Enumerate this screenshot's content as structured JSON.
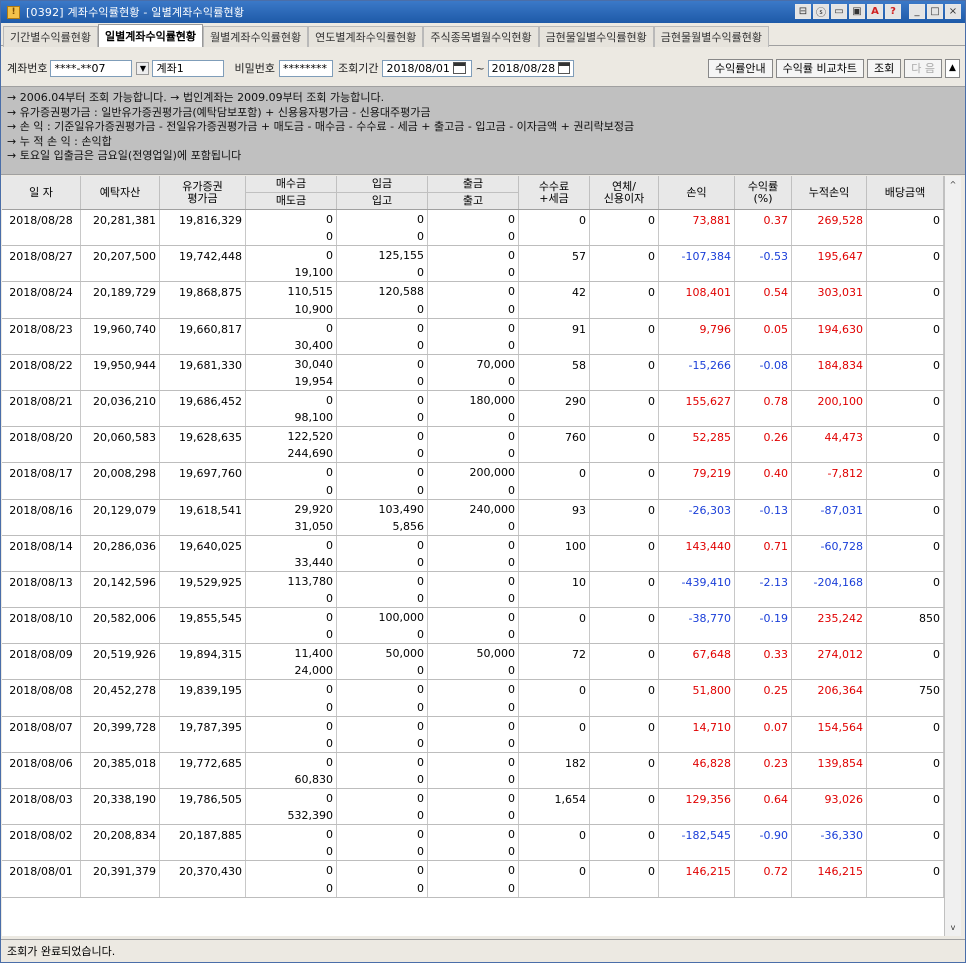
{
  "window": {
    "title": "[0392] 계좌수익률현황 - 일별계좌수익률현황",
    "buttons": [
      "⊟",
      "ⓢ",
      "▭",
      "▣",
      "A",
      "?",
      "_",
      "□",
      "×"
    ]
  },
  "tabs": [
    {
      "label": "기간별수익률현황",
      "active": false
    },
    {
      "label": "일별계좌수익률현황",
      "active": true
    },
    {
      "label": "월별계좌수익률현황",
      "active": false
    },
    {
      "label": "연도별계좌수익률현황",
      "active": false
    },
    {
      "label": "주식종목별월수익현황",
      "active": false
    },
    {
      "label": "금현물일별수익률현황",
      "active": false
    },
    {
      "label": "금현물월별수익률현황",
      "active": false
    }
  ],
  "query": {
    "account_label": "계좌번호",
    "account_value": "****-**07",
    "account_name": "계좌1",
    "password_label": "비밀번호",
    "password_value": "********",
    "period_label": "조회기간",
    "date_from": "2018/08/01",
    "date_sep": "~",
    "date_to": "2018/08/28",
    "btn_guide": "수익률안내",
    "btn_chart": "수익률 비교차트",
    "btn_search": "조회",
    "btn_next": "다 음",
    "btn_up": "▲"
  },
  "info": [
    "→ 2006.04부터 조회 가능합니다. → 법인계좌는 2009.09부터 조회 가능합니다.",
    "→ 유가증권평가금 : 일반유가증권평가금(예탁담보포함) + 신용융자평가금 - 신용대주평가금",
    "→ 손          익 : 기준일유가증권평가금 - 전일유가증권평가금 + 매도금 - 매수금 - 수수료 - 세금 + 출고금 - 입고금 - 이자금액 + 권리락보정금",
    "→ 누  적  손  익 : 손익합",
    "→ 토요일 입출금은 금요일(전영업일)에 포함됩니다"
  ],
  "headers": {
    "date": "일 자",
    "deposit": "예탁자산",
    "securities": [
      "유가증권",
      "평가금"
    ],
    "buy_sell": [
      "매수금",
      "매도금"
    ],
    "in": [
      "입금",
      "입고"
    ],
    "out": [
      "출금",
      "출고"
    ],
    "fee": [
      "수수료",
      "+세금"
    ],
    "overdue": [
      "연체/",
      "신용이자"
    ],
    "pnl": "손익",
    "rate": [
      "수익률",
      "(%)"
    ],
    "cum": "누적손익",
    "dividend": "배당금액"
  },
  "rows": [
    {
      "date": "2018/08/28",
      "deposit": "20,281,381",
      "sec": "19,816,329",
      "buy": "0",
      "sell": "0",
      "in_money": "0",
      "in_stock": "0",
      "out_money": "0",
      "out_stock": "0",
      "fee": "0",
      "overdue": "0",
      "pnl": "73,881",
      "rate": "0.37",
      "cum": "269,528",
      "div": "0",
      "pnl_sign": "pos",
      "cum_sign": "pos"
    },
    {
      "date": "2018/08/27",
      "deposit": "20,207,500",
      "sec": "19,742,448",
      "buy": "0",
      "sell": "19,100",
      "in_money": "125,155",
      "in_stock": "0",
      "out_money": "0",
      "out_stock": "0",
      "fee": "57",
      "overdue": "0",
      "pnl": "-107,384",
      "rate": "-0.53",
      "cum": "195,647",
      "div": "0",
      "pnl_sign": "neg",
      "cum_sign": "pos"
    },
    {
      "date": "2018/08/24",
      "deposit": "20,189,729",
      "sec": "19,868,875",
      "buy": "110,515",
      "sell": "10,900",
      "in_money": "120,588",
      "in_stock": "0",
      "out_money": "0",
      "out_stock": "0",
      "fee": "42",
      "overdue": "0",
      "pnl": "108,401",
      "rate": "0.54",
      "cum": "303,031",
      "div": "0",
      "pnl_sign": "pos",
      "cum_sign": "pos"
    },
    {
      "date": "2018/08/23",
      "deposit": "19,960,740",
      "sec": "19,660,817",
      "buy": "0",
      "sell": "30,400",
      "in_money": "0",
      "in_stock": "0",
      "out_money": "0",
      "out_stock": "0",
      "fee": "91",
      "overdue": "0",
      "pnl": "9,796",
      "rate": "0.05",
      "cum": "194,630",
      "div": "0",
      "pnl_sign": "pos",
      "cum_sign": "pos"
    },
    {
      "date": "2018/08/22",
      "deposit": "19,950,944",
      "sec": "19,681,330",
      "buy": "30,040",
      "sell": "19,954",
      "in_money": "0",
      "in_stock": "0",
      "out_money": "70,000",
      "out_stock": "0",
      "fee": "58",
      "overdue": "0",
      "pnl": "-15,266",
      "rate": "-0.08",
      "cum": "184,834",
      "div": "0",
      "pnl_sign": "neg",
      "cum_sign": "pos"
    },
    {
      "date": "2018/08/21",
      "deposit": "20,036,210",
      "sec": "19,686,452",
      "buy": "0",
      "sell": "98,100",
      "in_money": "0",
      "in_stock": "0",
      "out_money": "180,000",
      "out_stock": "0",
      "fee": "290",
      "overdue": "0",
      "pnl": "155,627",
      "rate": "0.78",
      "cum": "200,100",
      "div": "0",
      "pnl_sign": "pos",
      "cum_sign": "pos"
    },
    {
      "date": "2018/08/20",
      "deposit": "20,060,583",
      "sec": "19,628,635",
      "buy": "122,520",
      "sell": "244,690",
      "in_money": "0",
      "in_stock": "0",
      "out_money": "0",
      "out_stock": "0",
      "fee": "760",
      "overdue": "0",
      "pnl": "52,285",
      "rate": "0.26",
      "cum": "44,473",
      "div": "0",
      "pnl_sign": "pos",
      "cum_sign": "pos"
    },
    {
      "date": "2018/08/17",
      "deposit": "20,008,298",
      "sec": "19,697,760",
      "buy": "0",
      "sell": "0",
      "in_money": "0",
      "in_stock": "0",
      "out_money": "200,000",
      "out_stock": "0",
      "fee": "0",
      "overdue": "0",
      "pnl": "79,219",
      "rate": "0.40",
      "cum": "-7,812",
      "div": "0",
      "pnl_sign": "pos",
      "cum_sign": "pos"
    },
    {
      "date": "2018/08/16",
      "deposit": "20,129,079",
      "sec": "19,618,541",
      "buy": "29,920",
      "sell": "31,050",
      "in_money": "103,490",
      "in_stock": "5,856",
      "out_money": "240,000",
      "out_stock": "0",
      "fee": "93",
      "overdue": "0",
      "pnl": "-26,303",
      "rate": "-0.13",
      "cum": "-87,031",
      "div": "0",
      "pnl_sign": "neg",
      "cum_sign": "neg"
    },
    {
      "date": "2018/08/14",
      "deposit": "20,286,036",
      "sec": "19,640,025",
      "buy": "0",
      "sell": "33,440",
      "in_money": "0",
      "in_stock": "0",
      "out_money": "0",
      "out_stock": "0",
      "fee": "100",
      "overdue": "0",
      "pnl": "143,440",
      "rate": "0.71",
      "cum": "-60,728",
      "div": "0",
      "pnl_sign": "pos",
      "cum_sign": "neg"
    },
    {
      "date": "2018/08/13",
      "deposit": "20,142,596",
      "sec": "19,529,925",
      "buy": "113,780",
      "sell": "0",
      "in_money": "0",
      "in_stock": "0",
      "out_money": "0",
      "out_stock": "0",
      "fee": "10",
      "overdue": "0",
      "pnl": "-439,410",
      "rate": "-2.13",
      "cum": "-204,168",
      "div": "0",
      "pnl_sign": "neg",
      "cum_sign": "neg"
    },
    {
      "date": "2018/08/10",
      "deposit": "20,582,006",
      "sec": "19,855,545",
      "buy": "0",
      "sell": "0",
      "in_money": "100,000",
      "in_stock": "0",
      "out_money": "0",
      "out_stock": "0",
      "fee": "0",
      "overdue": "0",
      "pnl": "-38,770",
      "rate": "-0.19",
      "cum": "235,242",
      "div": "850",
      "pnl_sign": "neg",
      "cum_sign": "pos"
    },
    {
      "date": "2018/08/09",
      "deposit": "20,519,926",
      "sec": "19,894,315",
      "buy": "11,400",
      "sell": "24,000",
      "in_money": "50,000",
      "in_stock": "0",
      "out_money": "50,000",
      "out_stock": "0",
      "fee": "72",
      "overdue": "0",
      "pnl": "67,648",
      "rate": "0.33",
      "cum": "274,012",
      "div": "0",
      "pnl_sign": "pos",
      "cum_sign": "pos"
    },
    {
      "date": "2018/08/08",
      "deposit": "20,452,278",
      "sec": "19,839,195",
      "buy": "0",
      "sell": "0",
      "in_money": "0",
      "in_stock": "0",
      "out_money": "0",
      "out_stock": "0",
      "fee": "0",
      "overdue": "0",
      "pnl": "51,800",
      "rate": "0.25",
      "cum": "206,364",
      "div": "750",
      "pnl_sign": "pos",
      "cum_sign": "pos"
    },
    {
      "date": "2018/08/07",
      "deposit": "20,399,728",
      "sec": "19,787,395",
      "buy": "0",
      "sell": "0",
      "in_money": "0",
      "in_stock": "0",
      "out_money": "0",
      "out_stock": "0",
      "fee": "0",
      "overdue": "0",
      "pnl": "14,710",
      "rate": "0.07",
      "cum": "154,564",
      "div": "0",
      "pnl_sign": "pos",
      "cum_sign": "pos"
    },
    {
      "date": "2018/08/06",
      "deposit": "20,385,018",
      "sec": "19,772,685",
      "buy": "0",
      "sell": "60,830",
      "in_money": "0",
      "in_stock": "0",
      "out_money": "0",
      "out_stock": "0",
      "fee": "182",
      "overdue": "0",
      "pnl": "46,828",
      "rate": "0.23",
      "cum": "139,854",
      "div": "0",
      "pnl_sign": "pos",
      "cum_sign": "pos"
    },
    {
      "date": "2018/08/03",
      "deposit": "20,338,190",
      "sec": "19,786,505",
      "buy": "0",
      "sell": "532,390",
      "in_money": "0",
      "in_stock": "0",
      "out_money": "0",
      "out_stock": "0",
      "fee": "1,654",
      "overdue": "0",
      "pnl": "129,356",
      "rate": "0.64",
      "cum": "93,026",
      "div": "0",
      "pnl_sign": "pos",
      "cum_sign": "pos"
    },
    {
      "date": "2018/08/02",
      "deposit": "20,208,834",
      "sec": "20,187,885",
      "buy": "0",
      "sell": "0",
      "in_money": "0",
      "in_stock": "0",
      "out_money": "0",
      "out_stock": "0",
      "fee": "0",
      "overdue": "0",
      "pnl": "-182,545",
      "rate": "-0.90",
      "cum": "-36,330",
      "div": "0",
      "pnl_sign": "neg",
      "cum_sign": "neg"
    },
    {
      "date": "2018/08/01",
      "deposit": "20,391,379",
      "sec": "20,370,430",
      "buy": "0",
      "sell": "0",
      "in_money": "0",
      "in_stock": "0",
      "out_money": "0",
      "out_stock": "0",
      "fee": "0",
      "overdue": "0",
      "pnl": "146,215",
      "rate": "0.72",
      "cum": "146,215",
      "div": "0",
      "pnl_sign": "pos",
      "cum_sign": "pos"
    }
  ],
  "scroll": {
    "up": "^",
    "down": "v"
  },
  "status": "조회가 완료되었습니다.",
  "colors": {
    "positive": "#e00000",
    "negative": "#1a3ed8",
    "title_bar": "#1e5aa8"
  }
}
